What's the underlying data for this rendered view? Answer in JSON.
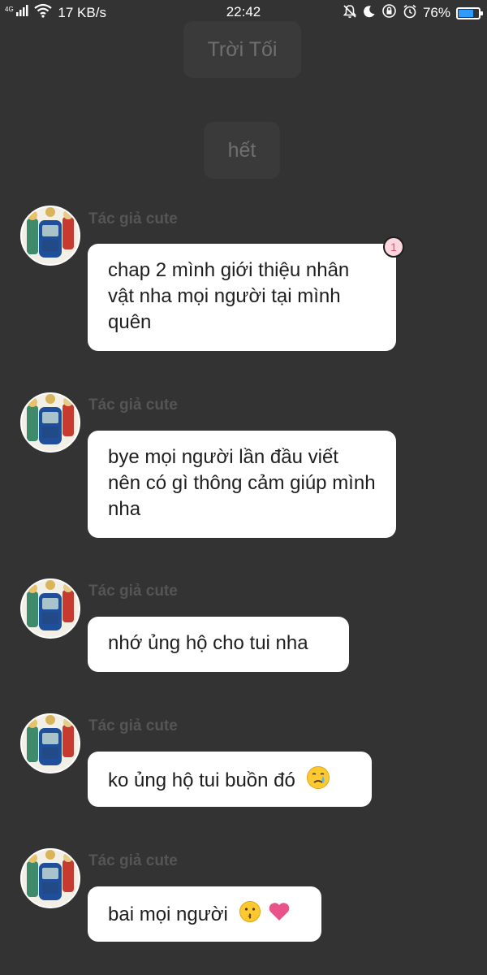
{
  "status_bar": {
    "network": "4G",
    "speed": "17 KB/s",
    "time": "22:42",
    "battery": "76%",
    "battery_level": 0.76,
    "icons": [
      "signal-icon",
      "wifi-icon",
      "silent-bell-icon",
      "moon-icon",
      "rotation-lock-icon",
      "alarm-icon",
      "battery-icon"
    ]
  },
  "system_messages": [
    "Trời Tối",
    "hết"
  ],
  "messages": [
    {
      "author": "Tác giả cute",
      "text": "chap 2 mình giới thiệu nhân vật nha mọi người tại mình quên",
      "badge": "1"
    },
    {
      "author": "Tác giả cute",
      "text": "bye mọi người lần đầu viết nên có gì thông cảm giúp mình nha"
    },
    {
      "author": "Tác giả cute",
      "text": "nhớ ủng hộ cho tui nha"
    },
    {
      "author": "Tác giả cute",
      "text": "ko ủng hộ tui buồn đó",
      "emoji": "crying-face-icon"
    },
    {
      "author": "Tác giả cute",
      "text": "bai mọi người",
      "emoji": "kissing-face-heart-icon"
    }
  ],
  "colors": {
    "background": "#333333",
    "bubble": "#ffffff",
    "chip": "#3a3a3a",
    "badge": "#fdd6de",
    "heart": "#e8548a"
  }
}
